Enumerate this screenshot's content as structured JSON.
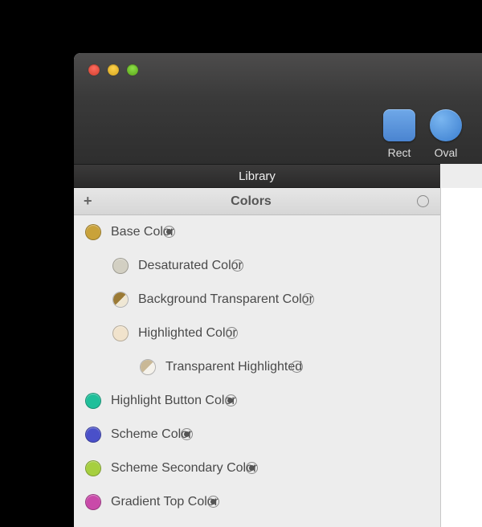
{
  "toolbar": {
    "tools": [
      {
        "id": "rect",
        "label": "Rect"
      },
      {
        "id": "oval",
        "label": "Oval"
      }
    ]
  },
  "tabs": {
    "active": "Library"
  },
  "section": {
    "title": "Colors",
    "add_label": "+",
    "selected": false
  },
  "items": [
    {
      "label": "Base Color",
      "indent": 0,
      "swatch": "#c9a23a",
      "swatch2": null,
      "selected": true
    },
    {
      "label": "Desaturated Color",
      "indent": 1,
      "swatch": "#d2cfc2",
      "swatch2": null,
      "selected": false
    },
    {
      "label": "Background Transparent Color",
      "indent": 1,
      "swatch": "#9b7a35",
      "swatch2": "#efe7d4",
      "selected": false
    },
    {
      "label": "Highlighted Color",
      "indent": 1,
      "swatch": "#f1e3cc",
      "swatch2": null,
      "selected": false
    },
    {
      "label": "Transparent Highlighted",
      "indent": 2,
      "swatch": "#c9b896",
      "swatch2": "#f5f2eb",
      "selected": false
    },
    {
      "label": "Highlight Button Color",
      "indent": 0,
      "swatch": "#1fbf9a",
      "swatch2": null,
      "selected": true
    },
    {
      "label": "Scheme Color",
      "indent": 0,
      "swatch": "#4a50c9",
      "swatch2": null,
      "selected": true
    },
    {
      "label": "Scheme Secondary Color",
      "indent": 0,
      "swatch": "#a6cf3f",
      "swatch2": null,
      "selected": true
    },
    {
      "label": "Gradient Top Color",
      "indent": 0,
      "swatch": "#c94aa9",
      "swatch2": null,
      "selected": true
    }
  ]
}
